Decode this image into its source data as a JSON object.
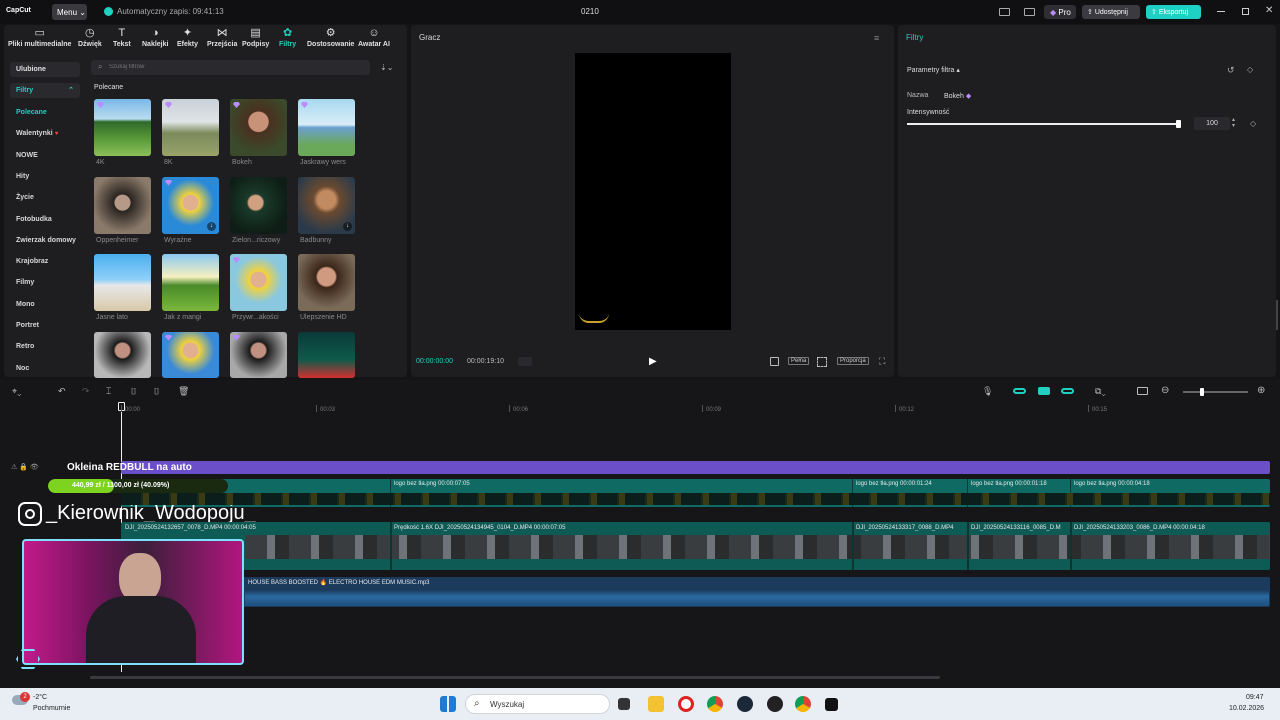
{
  "topbar": {
    "logo": "CapCut",
    "menu_label": "Menu",
    "autosave": "Automatyczny zapis: 09:41:13",
    "project_title": "0210",
    "pro_label": "Pro",
    "share_label": "Udostępnij",
    "export_label": "Eksportuj"
  },
  "tools": [
    {
      "label": "Pliki multimedialne",
      "icon": "media-icon"
    },
    {
      "label": "Dźwięk",
      "icon": "audio-icon"
    },
    {
      "label": "Tekst",
      "icon": "text-icon"
    },
    {
      "label": "Naklejki",
      "icon": "sticker-icon"
    },
    {
      "label": "Efekty",
      "icon": "effects-icon"
    },
    {
      "label": "Przejścia",
      "icon": "transitions-icon"
    },
    {
      "label": "Podpisy",
      "icon": "captions-icon"
    },
    {
      "label": "Filtry",
      "icon": "filters-icon"
    },
    {
      "label": "Dostosowanie",
      "icon": "adjust-icon"
    },
    {
      "label": "Awatar AI",
      "icon": "avatar-icon"
    }
  ],
  "sidebar": {
    "favorites": "Ulubione",
    "filters": "Filtry",
    "categories": [
      "Polecane",
      "Walentynki",
      "NOWE",
      "Hity",
      "Życie",
      "Fotobudka",
      "Zwierzak domowy",
      "Krajobraz",
      "Filmy",
      "Mono",
      "Portret",
      "Retro",
      "Noc"
    ]
  },
  "search": {
    "placeholder": "Szukaj filtrów"
  },
  "section_title": "Polecane",
  "filter_items": [
    {
      "label": "4K"
    },
    {
      "label": "8K"
    },
    {
      "label": "Bokeh"
    },
    {
      "label": "Jaskrawy wers"
    },
    {
      "label": "Oppenheimer"
    },
    {
      "label": "Wyraźne"
    },
    {
      "label": "Zielon...riczowy"
    },
    {
      "label": "Badbunny"
    },
    {
      "label": "Jasne lato"
    },
    {
      "label": "Jak z mangi"
    },
    {
      "label": "Przywr...akości"
    },
    {
      "label": "Ulepszenie HD"
    },
    {
      "label": ""
    },
    {
      "label": ""
    },
    {
      "label": ""
    },
    {
      "label": ""
    }
  ],
  "player": {
    "title": "Gracz",
    "time_current": "00:00:00:00",
    "time_total": "00:00:19:10",
    "full_label": "Pełna",
    "ratio_label": "Proporcja"
  },
  "props": {
    "title": "Filtry",
    "params_label": "Parametry filtra",
    "name_label": "Nazwa",
    "name_value": "Bokeh",
    "intensity_label": "Intensywność",
    "intensity_value": "100",
    "intensity_level": 100
  },
  "timeline": {
    "ruler": [
      "00:00",
      "00:03",
      "00:06",
      "00:09",
      "00:12",
      "00:15"
    ],
    "text_track": "Okleina REDBULL na auto",
    "progress_text": "440,99 zł / 1100,00 zł (40.09%)",
    "progress_fraction": 0.4009,
    "overlay_end": "05",
    "overlay_clips": [
      "logo bez tła.png  00:00:07:05",
      "logo bez tła.png  00:00:01:24",
      "logo bez tła.png  00:00:01:18",
      "logo bez tła.png  00:00:04:18"
    ],
    "main_clips": [
      "DJI_20250524132657_0078_D.MP4  00:00:04:05",
      "Prędkość 1.6X  DJI_20250524134945_0104_D.MP4  00:00:07:05",
      "DJI_20250524133317_0088_D.MP4",
      "DJI_20250524133116_0085_D.M",
      "DJI_20250524133203_0086_D.MP4  00:00:04:18"
    ],
    "audio_clip": "HOUSE BASS BOOSTED 🔥 ELECTRO HOUSE EDM MUSIC.mp3",
    "instagram_handle": "_Kierownik_Wodopoju_"
  },
  "taskbar": {
    "weather_badge": "2",
    "temp": "-2°C",
    "weather": "Pochmurnie",
    "search": "Wyszukaj",
    "time": "09:47",
    "date": "10.02.2026"
  },
  "colors": {
    "accent": "#20d0c0",
    "text_track": "#6a4fc8",
    "overlay_track": "#0e6a63",
    "audio_track": "#1b3a5c",
    "export_btn": "#1fd1c4",
    "progress": "#7ed321"
  }
}
